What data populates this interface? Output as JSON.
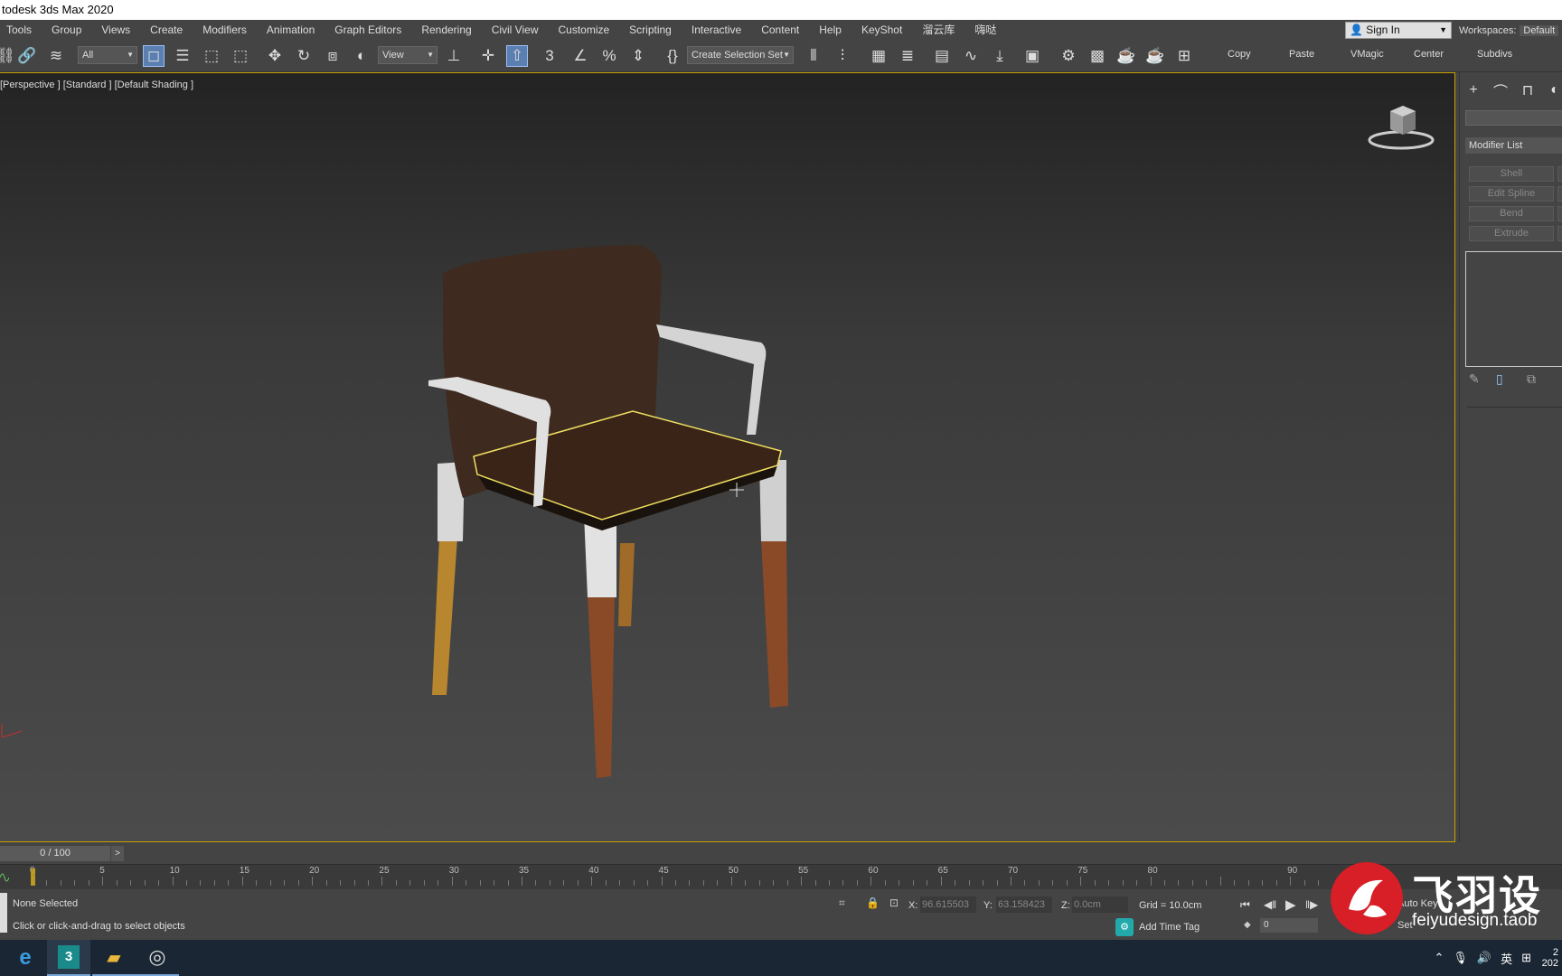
{
  "app": {
    "title": "todesk 3ds Max 2020"
  },
  "menu": [
    "Tools",
    "Group",
    "Views",
    "Create",
    "Modifiers",
    "Animation",
    "Graph Editors",
    "Rendering",
    "Civil View",
    "Customize",
    "Scripting",
    "Interactive",
    "Content",
    "Help",
    "KeyShot",
    "溜云库",
    "嗨哒"
  ],
  "account": {
    "signin_label": "Sign In",
    "workspaces_label": "Workspaces:",
    "workspace_value": "Default"
  },
  "toolbar": {
    "selection_filter": "All",
    "ref_coord": "View",
    "named_selection": "Create Selection Set",
    "quick_buttons": [
      "Copy",
      "Paste",
      "VMagic",
      "Center",
      "Subdivs"
    ]
  },
  "viewport": {
    "label": "[Perspective ] [Standard ] [Default Shading ]"
  },
  "command_panel": {
    "modifier_list_label": "Modifier List",
    "modifier_buttons": [
      "Shell",
      "Edit Spline",
      "Bend",
      "Extrude"
    ]
  },
  "timeslider": {
    "position": "0 / 100",
    "next_label": ">"
  },
  "trackbar": {
    "labels": [
      "0",
      "5",
      "10",
      "15",
      "20",
      "25",
      "30",
      "35",
      "40",
      "45",
      "50",
      "55",
      "60",
      "65",
      "70",
      "75",
      "80",
      "90"
    ],
    "current_frame": 0
  },
  "status": {
    "selection": "None Selected",
    "prompt": "Click or click-and-drag to select objects",
    "x_label": "X:",
    "x_value": "96.615503",
    "y_label": "Y:",
    "y_value": "63.158423",
    "z_label": "Z:",
    "z_value": "0.0cm",
    "grid": "Grid = 10.0cm",
    "add_time_tag": "Add Time Tag",
    "frame_value": "0",
    "auto_key": "Auto Key",
    "set_key": "Set"
  },
  "watermark": {
    "brand": "飞羽设",
    "url": "feiyudesign.taob"
  },
  "taskbar": {
    "tray_ime": "英",
    "clock_time": "2",
    "clock_date": "202"
  },
  "colors": {
    "selection_outline": "#f0e060",
    "viewport_border": "#c9a200",
    "active_tool": "#5a7fb0",
    "seat": "#3a2418",
    "wood_leg": "#8a4a28",
    "white_frame": "#d8d8d8",
    "watermark_red": "#d81e27"
  }
}
